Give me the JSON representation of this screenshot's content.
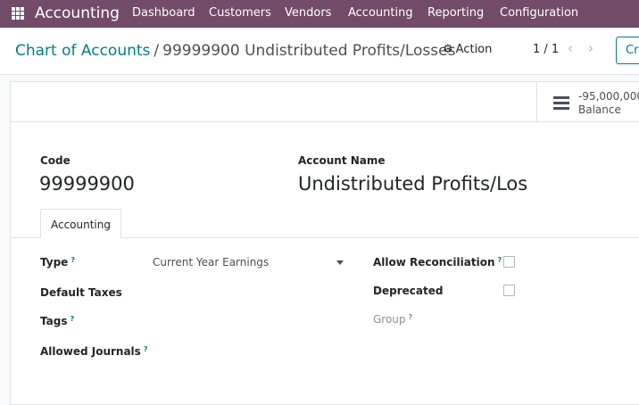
{
  "navbar": {
    "app_name": "Accounting",
    "menu": [
      "Dashboard",
      "Customers",
      "Vendors",
      "Accounting",
      "Reporting",
      "Configuration"
    ]
  },
  "breadcrumb": {
    "parent": "Chart of Accounts",
    "separator": "/",
    "current": "99999900 Undistributed Profits/Losses"
  },
  "toolbar": {
    "action_label": "Action",
    "pager": "1 / 1",
    "prev": "‹",
    "next": "›",
    "create_label": "Cre"
  },
  "stat_button": {
    "value": "-95,000,000.",
    "label": "Balance"
  },
  "form": {
    "code_label": "Code",
    "code_value": "99999900",
    "name_label": "Account Name",
    "name_value": "Undistributed Profits/Loss"
  },
  "tabs": [
    "Accounting"
  ],
  "fields": {
    "type_label": "Type",
    "type_value": "Current Year Earnings",
    "default_taxes_label": "Default Taxes",
    "tags_label": "Tags",
    "allowed_journals_label": "Allowed Journals",
    "allow_reconciliation_label": "Allow Reconciliation",
    "allow_reconciliation_value": false,
    "deprecated_label": "Deprecated",
    "deprecated_value": false,
    "group_label": "Group",
    "help_mark": "?"
  },
  "colors": {
    "brand": "#714b67",
    "link": "#017e84"
  }
}
